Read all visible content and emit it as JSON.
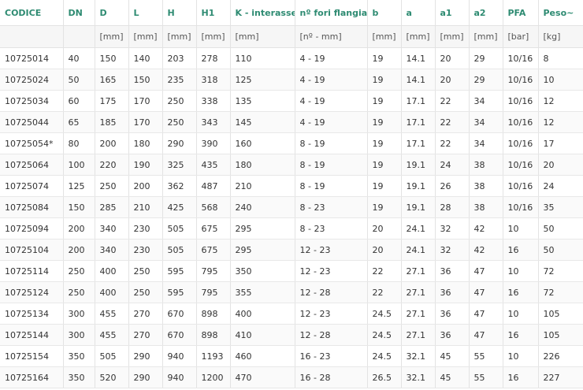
{
  "table": {
    "headers": [
      "CODICE",
      "DN",
      "D",
      "L",
      "H",
      "H1",
      "K - interasse",
      "nº fori flangia",
      "b",
      "a",
      "a1",
      "a2",
      "PFA",
      "Peso~"
    ],
    "units": [
      "",
      "",
      "[mm]",
      "[mm]",
      "[mm]",
      "[mm]",
      "[mm]",
      "[nº - mm]",
      "[mm]",
      "[mm]",
      "[mm]",
      "[mm]",
      "[bar]",
      "[kg]"
    ],
    "rows": [
      [
        "10725014",
        "40",
        "150",
        "140",
        "203",
        "278",
        "110",
        "4 - 19",
        "19",
        "14.1",
        "20",
        "29",
        "10/16",
        "8"
      ],
      [
        "10725024",
        "50",
        "165",
        "150",
        "235",
        "318",
        "125",
        "4 - 19",
        "19",
        "14.1",
        "20",
        "29",
        "10/16",
        "10"
      ],
      [
        "10725034",
        "60",
        "175",
        "170",
        "250",
        "338",
        "135",
        "4 - 19",
        "19",
        "17.1",
        "22",
        "34",
        "10/16",
        "12"
      ],
      [
        "10725044",
        "65",
        "185",
        "170",
        "250",
        "343",
        "145",
        "4 - 19",
        "19",
        "17.1",
        "22",
        "34",
        "10/16",
        "12"
      ],
      [
        "10725054*",
        "80",
        "200",
        "180",
        "290",
        "390",
        "160",
        "8 - 19",
        "19",
        "17.1",
        "22",
        "34",
        "10/16",
        "17"
      ],
      [
        "10725064",
        "100",
        "220",
        "190",
        "325",
        "435",
        "180",
        "8 - 19",
        "19",
        "19.1",
        "24",
        "38",
        "10/16",
        "20"
      ],
      [
        "10725074",
        "125",
        "250",
        "200",
        "362",
        "487",
        "210",
        "8 - 19",
        "19",
        "19.1",
        "26",
        "38",
        "10/16",
        "24"
      ],
      [
        "10725084",
        "150",
        "285",
        "210",
        "425",
        "568",
        "240",
        "8 - 23",
        "19",
        "19.1",
        "28",
        "38",
        "10/16",
        "35"
      ],
      [
        "10725094",
        "200",
        "340",
        "230",
        "505",
        "675",
        "295",
        "8 - 23",
        "20",
        "24.1",
        "32",
        "42",
        "10",
        "50"
      ],
      [
        "10725104",
        "200",
        "340",
        "230",
        "505",
        "675",
        "295",
        "12 - 23",
        "20",
        "24.1",
        "32",
        "42",
        "16",
        "50"
      ],
      [
        "10725114",
        "250",
        "400",
        "250",
        "595",
        "795",
        "350",
        "12 - 23",
        "22",
        "27.1",
        "36",
        "47",
        "10",
        "72"
      ],
      [
        "10725124",
        "250",
        "400",
        "250",
        "595",
        "795",
        "355",
        "12 - 28",
        "22",
        "27.1",
        "36",
        "47",
        "16",
        "72"
      ],
      [
        "10725134",
        "300",
        "455",
        "270",
        "670",
        "898",
        "400",
        "12 - 23",
        "24.5",
        "27.1",
        "36",
        "47",
        "10",
        "105"
      ],
      [
        "10725144",
        "300",
        "455",
        "270",
        "670",
        "898",
        "410",
        "12 - 28",
        "24.5",
        "27.1",
        "36",
        "47",
        "16",
        "105"
      ],
      [
        "10725154",
        "350",
        "505",
        "290",
        "940",
        "1193",
        "460",
        "16 - 23",
        "24.5",
        "32.1",
        "45",
        "55",
        "10",
        "226"
      ],
      [
        "10725164",
        "350",
        "520",
        "290",
        "940",
        "1200",
        "470",
        "16 - 28",
        "26.5",
        "32.1",
        "45",
        "55",
        "16",
        "227"
      ]
    ]
  },
  "colors": {
    "header_text": "#2e8b72",
    "units_bg": "#f6f6f6",
    "grid": "#e3e3e3"
  }
}
